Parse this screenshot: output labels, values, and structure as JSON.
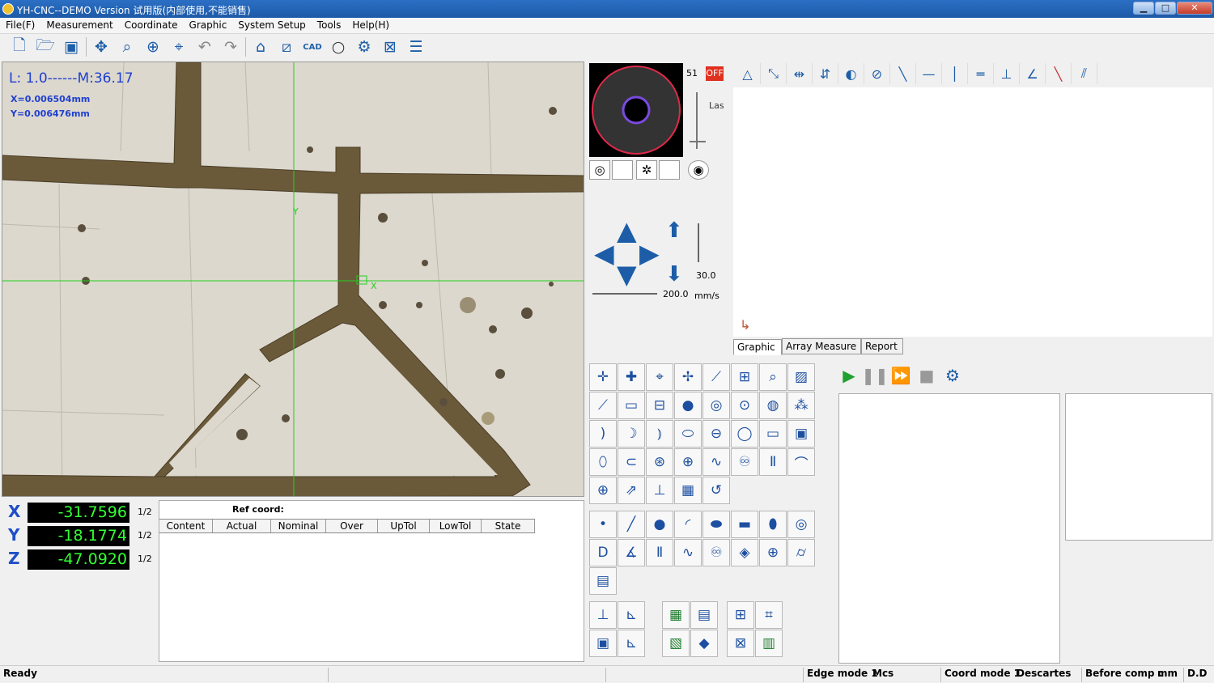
{
  "window": {
    "title": "YH-CNC--DEMO  Version  试用版(内部使用,不能销售)",
    "minimize": "▁",
    "maximize": "□",
    "close": "✕"
  },
  "menu": [
    "File(F)",
    "Measurement",
    "Coordinate",
    "Graphic",
    "System Setup",
    "Tools",
    "Help(H)"
  ],
  "toolbar_icons": [
    "new-file-icon",
    "open-folder-icon",
    "save-icon",
    "move-icon",
    "zoom-window-icon",
    "target-icon",
    "auto-focus-icon",
    "undo-icon",
    "redo-icon",
    "home-icon",
    "probe-icon",
    "cad-icon",
    "circle-icon",
    "settings-gear-icon",
    "fit-view-icon",
    "list-icon"
  ],
  "camera": {
    "lens": "L: 1.0------M:36.17",
    "x_readout": "X=0.006504mm",
    "y_readout": "Y=0.006476mm",
    "crosshair_y_label": "Y",
    "crosshair_x_label": "X"
  },
  "dro": [
    {
      "axis": "X",
      "value": "-31.7596",
      "resolution": "1/2"
    },
    {
      "axis": "Y",
      "value": "-18.1774",
      "resolution": "1/2"
    },
    {
      "axis": "Z",
      "value": "-47.0920",
      "resolution": "1/2"
    }
  ],
  "results": {
    "ref_coord": "Ref coord:",
    "columns": [
      "Content",
      "Actual",
      "Nominal",
      "Over",
      "UpTol",
      "LowTol",
      "State"
    ]
  },
  "light": {
    "level": "51",
    "off": "OFF",
    "laser": "Las"
  },
  "jog": {
    "z_speed": "30.0",
    "xy_speed": "200.0",
    "unit": "mm/s"
  },
  "tabs": [
    "Graphic",
    "Array Measure",
    "Report"
  ],
  "status": {
    "ready": "Ready",
    "edge_mode": "Edge mode 1",
    "mcs": "Mcs",
    "coord_mode": "Coord mode 1",
    "descartes": "Descartes",
    "comp": "Before comp c",
    "unit": "mm",
    "dd": "D.D"
  },
  "colors": {
    "title_bar": "#1d5aa8",
    "dro_text": "#33ff33",
    "axis_label": "#1e4fc8",
    "crosshair": "#20d020",
    "trace": "#6b5a3a",
    "surface": "#dcd8cd"
  }
}
